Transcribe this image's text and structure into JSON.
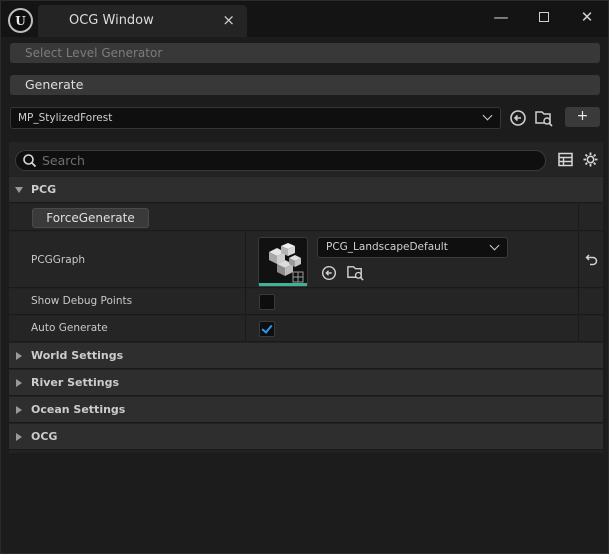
{
  "window": {
    "tab_title": "OCG Window",
    "tab_close_glyph": "×",
    "minimize_glyph": "—",
    "close_glyph": "✕"
  },
  "toolbar": {
    "select_level_label": "Select Level Generator",
    "generate_label": "Generate",
    "asset_value": "MP_StylizedForest",
    "add_label": "+"
  },
  "search": {
    "placeholder": "Search"
  },
  "categories": {
    "pcg": "PCG",
    "world": "World Settings",
    "river": "River Settings",
    "ocean": "Ocean Settings",
    "ocg": "OCG"
  },
  "pcg": {
    "force_generate_label": "ForceGenerate",
    "pcg_graph_label": "PCGGraph",
    "pcg_graph_value": "PCG_LandscapeDefault",
    "show_debug_label": "Show Debug Points",
    "show_debug_checked": false,
    "auto_generate_label": "Auto Generate",
    "auto_generate_checked": true
  },
  "colors": {
    "accent_check": "#2a9bf0",
    "thumbnail_underline": "#3ab59a"
  }
}
